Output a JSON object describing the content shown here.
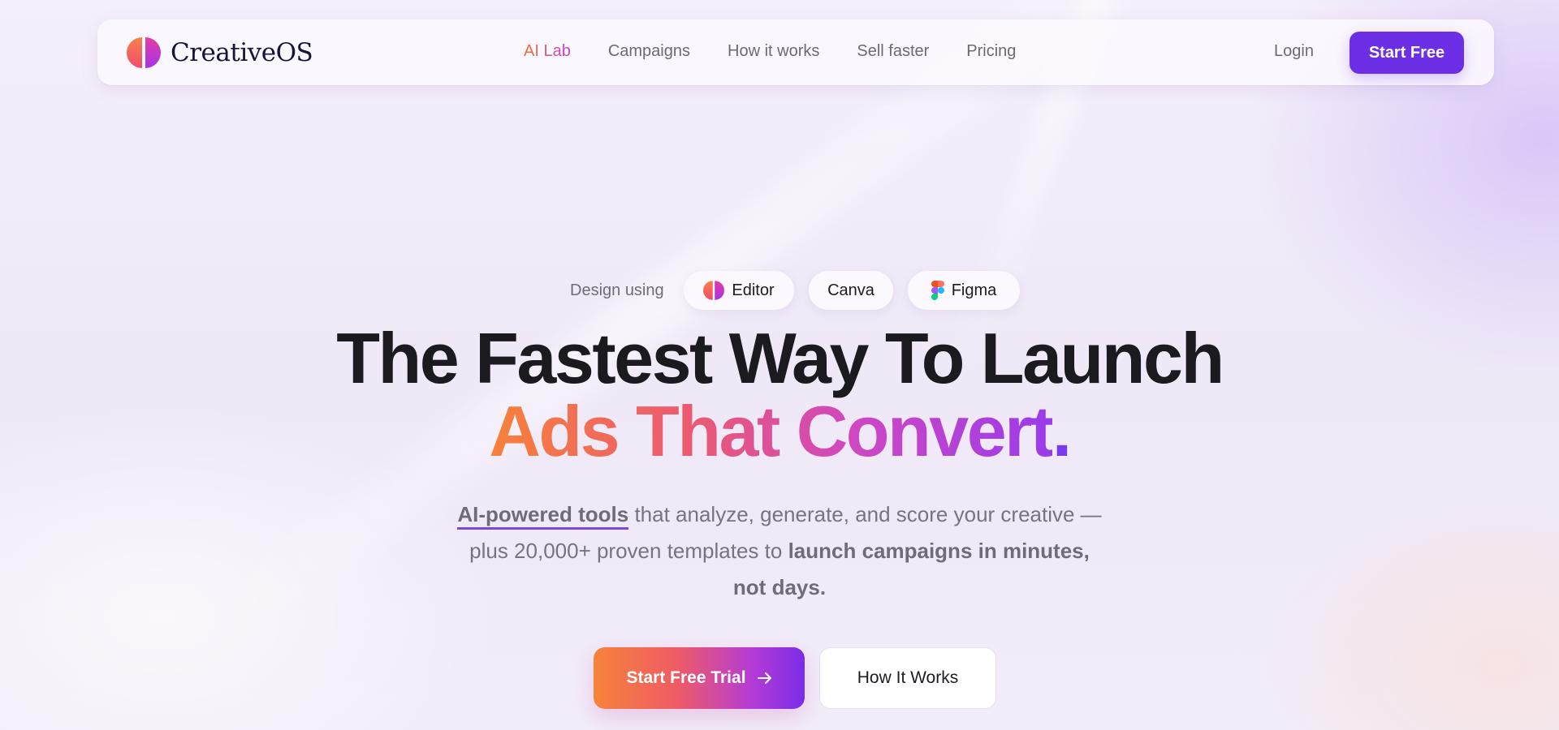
{
  "brand": {
    "name": "CreativeOS",
    "logo_icon": "creativeos-logo-icon"
  },
  "nav": {
    "links": [
      "AI Lab",
      "Campaigns",
      "How it works",
      "Sell faster",
      "Pricing"
    ],
    "login_label": "Login",
    "start_free_label": "Start Free"
  },
  "design_using": {
    "label": "Design using",
    "tools": [
      {
        "label": "Editor",
        "icon": "creativeos-logo-icon"
      },
      {
        "label": "Canva"
      },
      {
        "label": "Figma",
        "icon": "figma-icon"
      }
    ]
  },
  "hero": {
    "headline_line1": "The Fastest Way To Launch",
    "headline_line2": "Ads That Convert",
    "headline_dot": ".",
    "sub_highlight": "AI-powered tools",
    "sub_middle": " that analyze, generate, and score your creative — plus 20,000+ proven templates to ",
    "sub_bold": "launch campaigns in minutes, not days."
  },
  "cta": {
    "primary_label": "Start Free Trial",
    "primary_icon": "arrow-right-icon",
    "secondary_label": "How It Works"
  },
  "colors": {
    "accent_purple": "#6d2fe6",
    "gradient_orange": "#f7813a",
    "gradient_pink": "#ec5a70",
    "gradient_violet": "#9a3bea",
    "background": "#f3eef9"
  }
}
